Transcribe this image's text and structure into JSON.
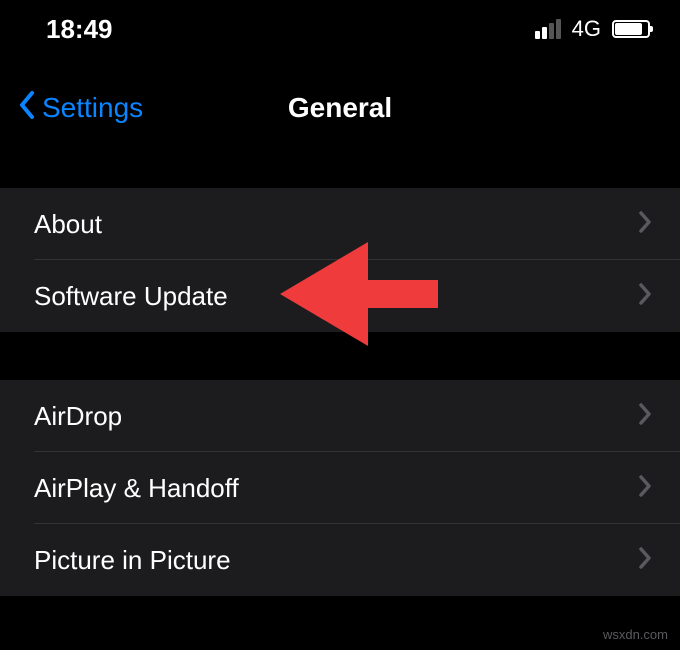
{
  "status": {
    "time": "18:49",
    "network": "4G"
  },
  "nav": {
    "back_label": "Settings",
    "title": "General"
  },
  "groups": [
    {
      "items": [
        {
          "label": "About",
          "name": "row-about"
        },
        {
          "label": "Software Update",
          "name": "row-software-update"
        }
      ]
    },
    {
      "items": [
        {
          "label": "AirDrop",
          "name": "row-airdrop"
        },
        {
          "label": "AirPlay & Handoff",
          "name": "row-airplay-handoff"
        },
        {
          "label": "Picture in Picture",
          "name": "row-picture-in-picture"
        }
      ]
    }
  ],
  "annotation": {
    "arrow_color": "#ef3b3b"
  },
  "watermark": "wsxdn.com"
}
